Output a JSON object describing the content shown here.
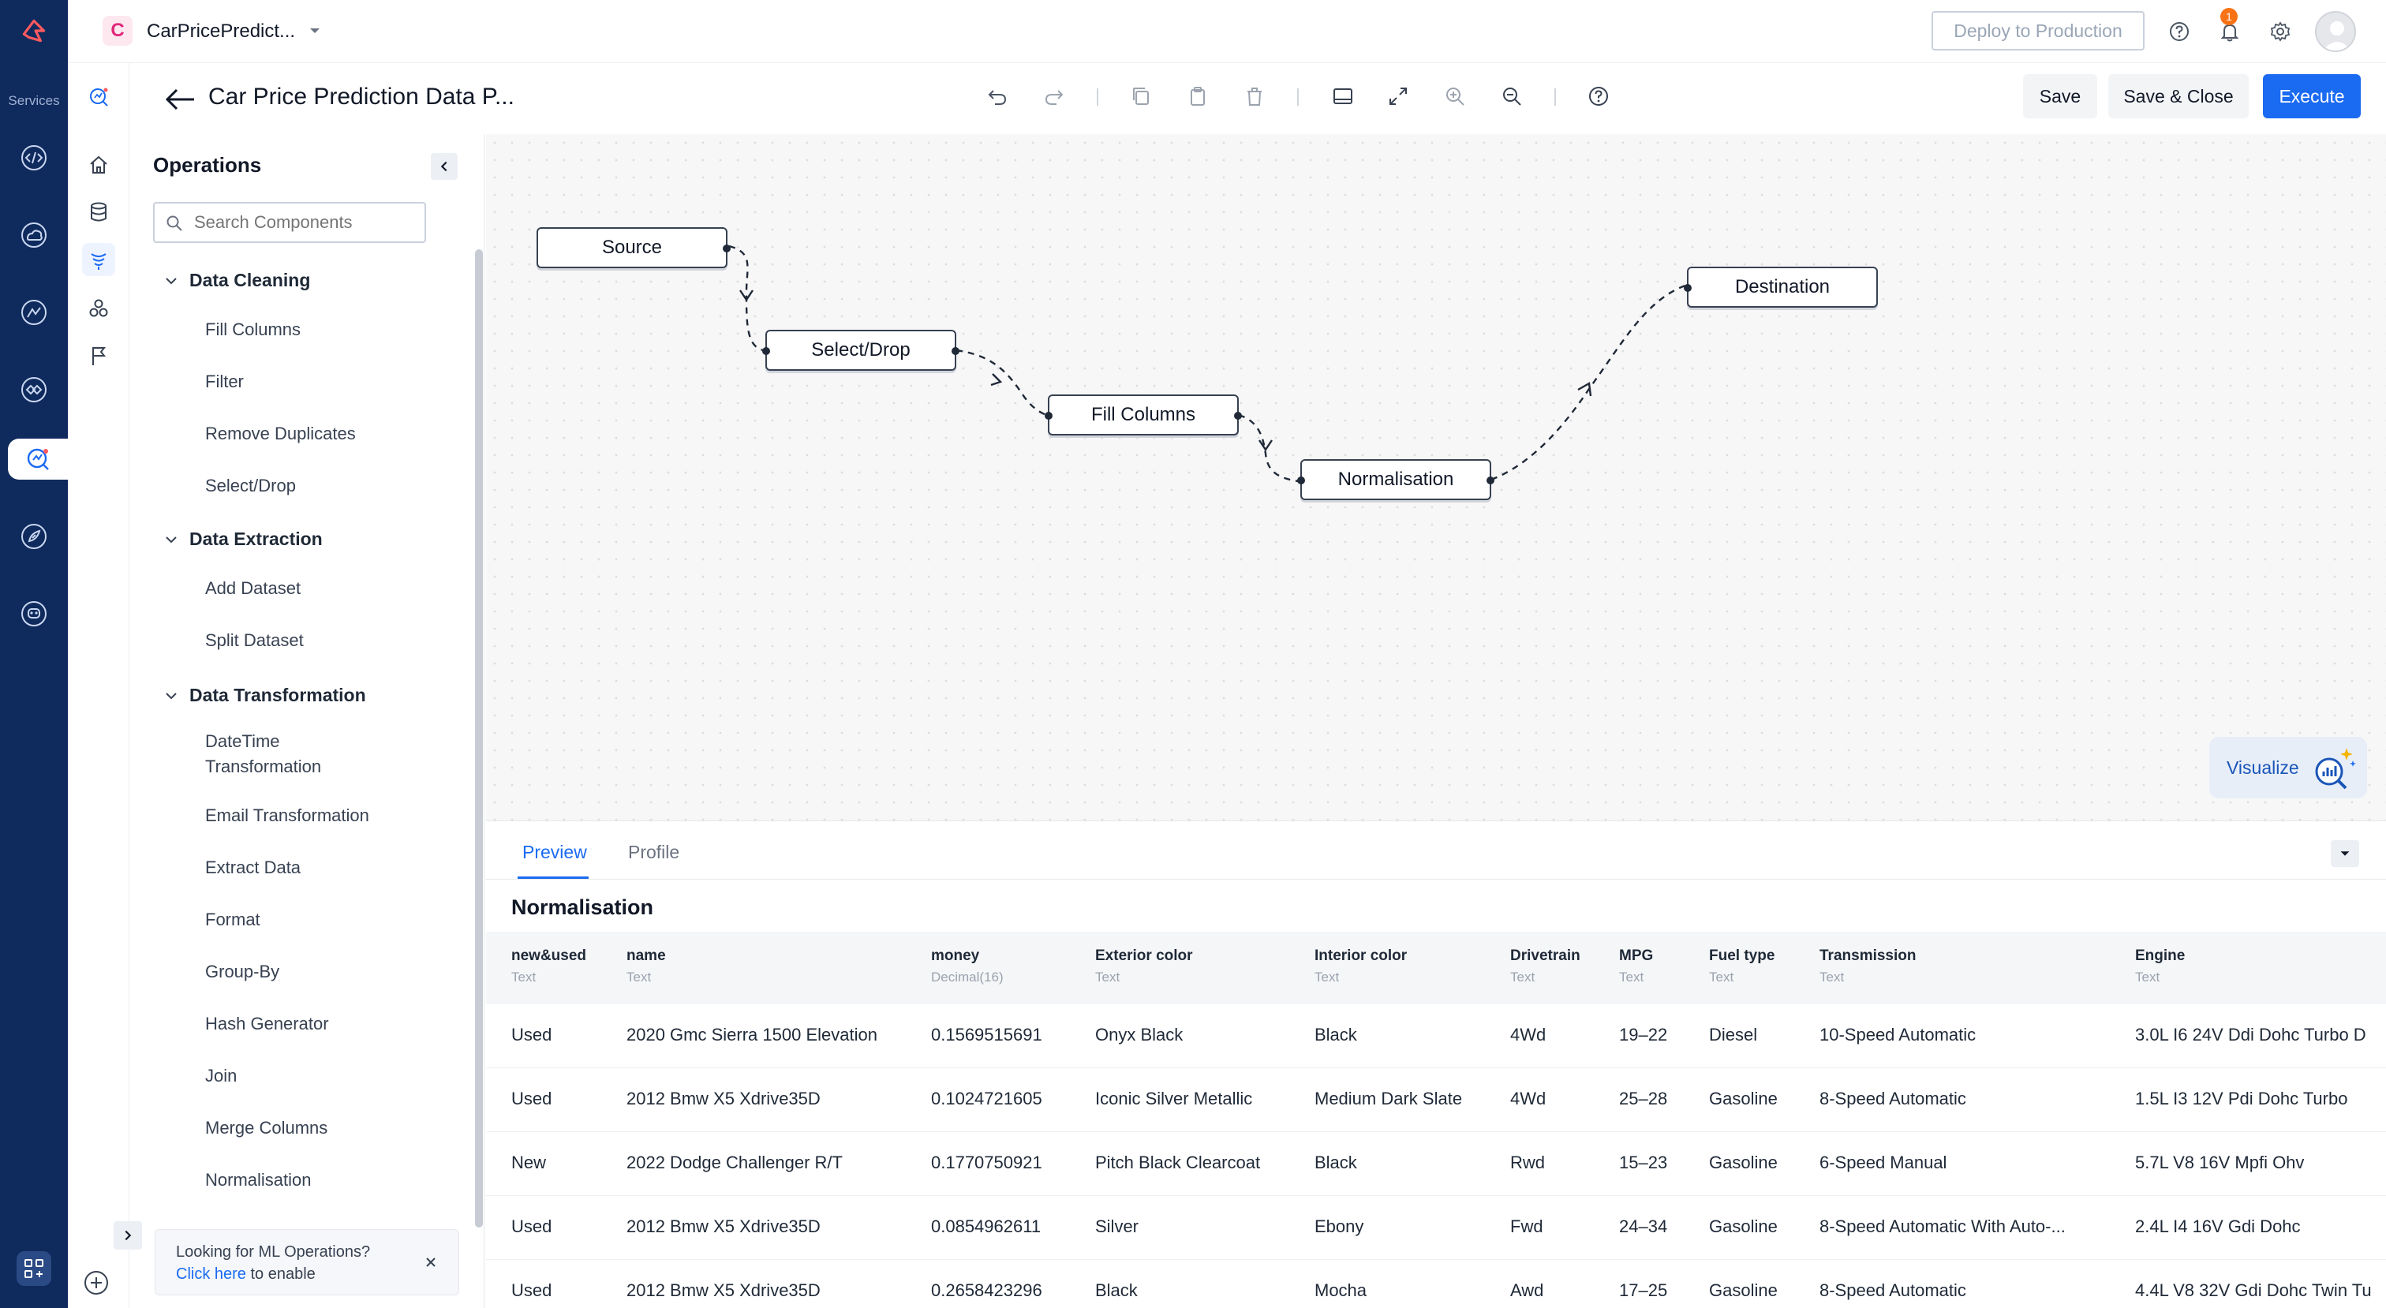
{
  "rail": {
    "services_label": "Services"
  },
  "topbar": {
    "project_initial": "C",
    "project_name": "CarPricePredict...",
    "deploy_label": "Deploy to Production",
    "notifications_count": "1"
  },
  "header": {
    "title": "Car Price Prediction Data P...",
    "save_label": "Save",
    "save_close_label": "Save & Close",
    "execute_label": "Execute"
  },
  "ops": {
    "title": "Operations",
    "search_placeholder": "Search Components",
    "groups": [
      {
        "label": "Data Cleaning",
        "items": [
          "Fill Columns",
          "Filter",
          "Remove Duplicates",
          "Select/Drop"
        ]
      },
      {
        "label": "Data Extraction",
        "items": [
          "Add Dataset",
          "Split Dataset"
        ]
      },
      {
        "label": "Data Transformation",
        "items": [
          "DateTime Transformation",
          "Email Transformation",
          "Extract Data",
          "Format",
          "Group-By",
          "Hash Generator",
          "Join",
          "Merge Columns",
          "Normalisation"
        ]
      }
    ],
    "banner_text": "Looking for ML Operations?",
    "banner_link": "Click here",
    "banner_suffix": " to enable"
  },
  "canvas": {
    "nodes": {
      "source": "Source",
      "select_drop": "Select/Drop",
      "fill_columns": "Fill Columns",
      "normalisation": "Normalisation",
      "destination": "Destination"
    },
    "visualize_label": "Visualize"
  },
  "preview": {
    "tabs": [
      "Preview",
      "Profile"
    ],
    "title": "Normalisation",
    "columns": [
      {
        "name": "new&used",
        "type": "Text"
      },
      {
        "name": "name",
        "type": "Text"
      },
      {
        "name": "money",
        "type": "Decimal(16)"
      },
      {
        "name": "Exterior color",
        "type": "Text"
      },
      {
        "name": "Interior color",
        "type": "Text"
      },
      {
        "name": "Drivetrain",
        "type": "Text"
      },
      {
        "name": "MPG",
        "type": "Text"
      },
      {
        "name": "Fuel type",
        "type": "Text"
      },
      {
        "name": "Transmission",
        "type": "Text"
      },
      {
        "name": "Engine",
        "type": "Text"
      }
    ],
    "rows": [
      [
        "Used",
        "2020 Gmc Sierra 1500 Elevation",
        "0.1569515691",
        "Onyx Black",
        "Black",
        "4Wd",
        "19–22",
        "Diesel",
        "10-Speed Automatic",
        "3.0L I6 24V Ddi Dohc Turbo D"
      ],
      [
        "Used",
        "2012 Bmw X5 Xdrive35D",
        "0.1024721605",
        "Iconic Silver Metallic",
        "Medium Dark Slate",
        "4Wd",
        "25–28",
        "Gasoline",
        "8-Speed Automatic",
        "1.5L I3 12V Pdi Dohc Turbo"
      ],
      [
        "New",
        "2022 Dodge Challenger R/T",
        "0.1770750921",
        "Pitch Black Clearcoat",
        "Black",
        "Rwd",
        "15–23",
        "Gasoline",
        "6-Speed Manual",
        "5.7L V8 16V Mpfi Ohv"
      ],
      [
        "Used",
        "2012 Bmw X5 Xdrive35D",
        "0.0854962611",
        "Silver",
        "Ebony",
        "Fwd",
        "24–34",
        "Gasoline",
        "8-Speed Automatic With Auto-...",
        "2.4L I4 16V Gdi Dohc"
      ],
      [
        "Used",
        "2012 Bmw X5 Xdrive35D",
        "0.2658423296",
        "Black",
        "Mocha",
        "Awd",
        "17–25",
        "Gasoline",
        "8-Speed Automatic",
        "4.4L V8 32V Gdi Dohc Twin Tu"
      ]
    ]
  }
}
